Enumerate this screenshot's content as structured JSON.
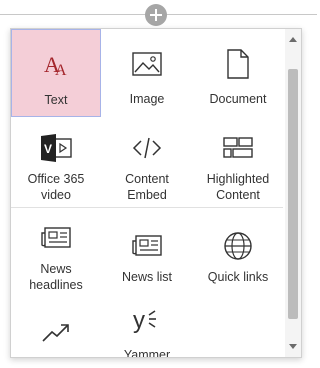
{
  "toolbox": {
    "add_label": "+",
    "tiles": [
      {
        "label": "Text",
        "icon": "text-icon"
      },
      {
        "label": "Image",
        "icon": "image-icon"
      },
      {
        "label": "Document",
        "icon": "document-icon"
      },
      {
        "label": "Office 365 video",
        "icon": "office365-video-icon"
      },
      {
        "label": "Content Embed",
        "icon": "code-embed-icon"
      },
      {
        "label": "Highlighted Content",
        "icon": "highlighted-content-icon"
      },
      {
        "label": "News headlines",
        "icon": "news-icon"
      },
      {
        "label": "News list",
        "icon": "news-icon"
      },
      {
        "label": "Quick links",
        "icon": "globe-icon"
      },
      {
        "label": "",
        "icon": "trend-icon"
      },
      {
        "label": "Yammer",
        "icon": "yammer-icon"
      }
    ]
  },
  "colors": {
    "selected_bg": "#f4ced7",
    "selected_border": "#a7b3e8",
    "text_icon_accent": "#a4262c"
  }
}
